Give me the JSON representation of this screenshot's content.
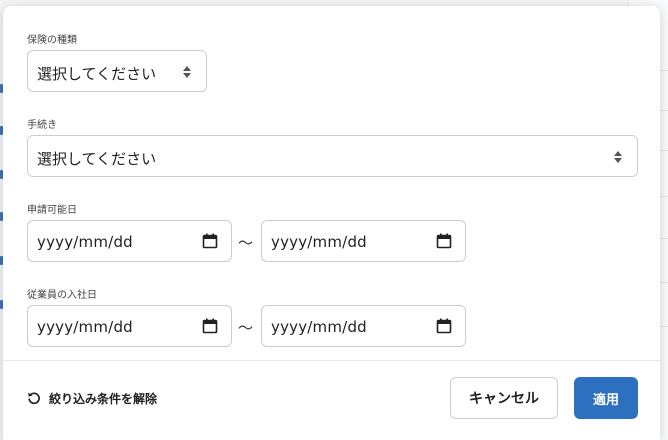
{
  "filters": {
    "insurance_type": {
      "label": "保険の種類",
      "value": "選択してください"
    },
    "procedure": {
      "label": "手続き",
      "value": "選択してください"
    },
    "application_date": {
      "label": "申請可能日",
      "from_placeholder": "yyyy/mm/dd",
      "to_placeholder": "yyyy/mm/dd",
      "separator": "～"
    },
    "hire_date": {
      "label": "従業員の入社日",
      "from_placeholder": "yyyy/mm/dd",
      "to_placeholder": "yyyy/mm/dd",
      "separator": "～"
    }
  },
  "footer": {
    "reset_label": "絞り込み条件を解除",
    "reset_icon": "undo-icon",
    "cancel_label": "キャンセル",
    "apply_label": "適用"
  },
  "colors": {
    "primary": "#2d70c0",
    "border": "#c9cdd2"
  }
}
